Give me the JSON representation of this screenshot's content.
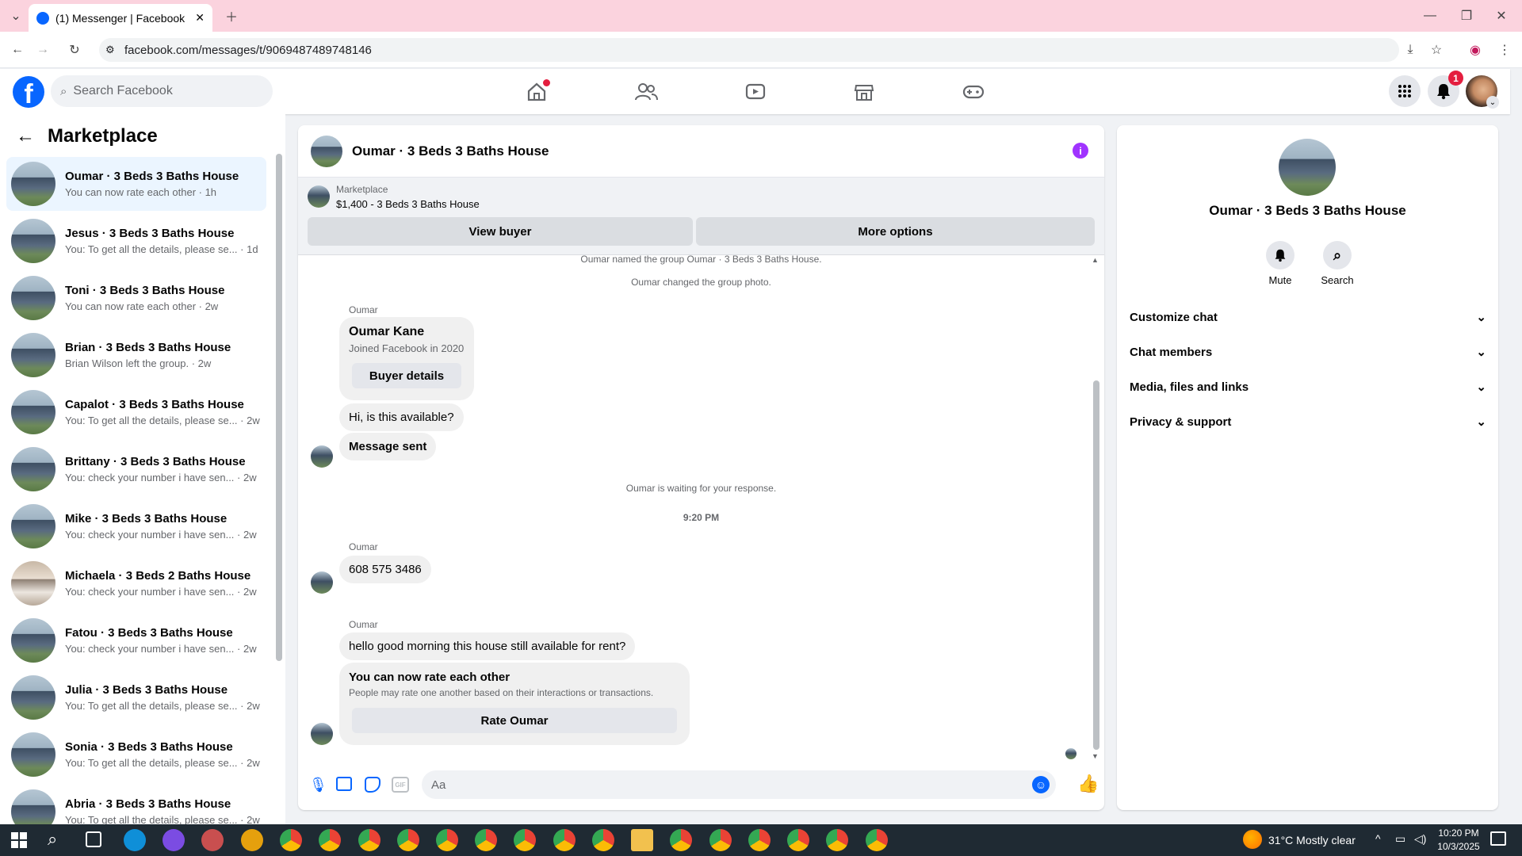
{
  "browser": {
    "tab_title": "(1) Messenger | Facebook",
    "url": "facebook.com/messages/t/9069487489748146"
  },
  "header": {
    "search_placeholder": "Search Facebook",
    "notification_count": "1"
  },
  "sidebar": {
    "title": "Marketplace",
    "conversations": [
      {
        "title": "Oumar · 3 Beds 3 Baths House",
        "preview": "You can now rate each other · 1h"
      },
      {
        "title": "Jesus · 3 Beds 3 Baths House",
        "preview": "You: To get all the details, please se... · 1d"
      },
      {
        "title": "Toni · 3 Beds 3 Baths House",
        "preview": "You can now rate each other · 2w"
      },
      {
        "title": "Brian · 3 Beds 3 Baths House",
        "preview": "Brian Wilson left the group. · 2w"
      },
      {
        "title": "Capalot · 3 Beds 3 Baths House",
        "preview": "You: To get all the details, please se... · 2w"
      },
      {
        "title": "Brittany · 3 Beds 3 Baths House",
        "preview": "You: check your number i have sen... · 2w"
      },
      {
        "title": "Mike · 3 Beds 3 Baths House",
        "preview": "You: check your number i have sen... · 2w"
      },
      {
        "title": "Michaela · 3 Beds 2 Baths House",
        "preview": "You: check your number i have sen... · 2w"
      },
      {
        "title": "Fatou · 3 Beds 3 Baths House",
        "preview": "You: check your number i have sen... · 2w"
      },
      {
        "title": "Julia · 3 Beds 3 Baths House",
        "preview": "You: To get all the details, please se... · 2w"
      },
      {
        "title": "Sonia · 3 Beds 3 Baths House",
        "preview": "You: To get all the details, please se... · 2w"
      },
      {
        "title": "Abria · 3 Beds 3 Baths House",
        "preview": "You: To get all the details, please se... · 2w"
      }
    ]
  },
  "chat": {
    "title": "Oumar · 3 Beds 3 Baths House",
    "listing_source": "Marketplace",
    "listing_title": "$1,400 - 3 Beds 3 Baths House",
    "view_buyer": "View buyer",
    "more_options": "More options",
    "sys1": "Oumar named the group Oumar · 3 Beds 3 Baths House.",
    "sys2": "Oumar changed the group photo.",
    "sender": "Oumar",
    "card_name": "Oumar Kane",
    "card_sub": "Joined Facebook in 2020",
    "buyer_details": "Buyer details",
    "msg1": "Hi, is this available?",
    "msg2": "Message sent",
    "waiting": "Oumar is waiting for your response.",
    "time": "9:20 PM",
    "msg3": "608 575 3486",
    "msg4": "hello good morning this house still available for rent?",
    "rate_title": "You can now rate each other",
    "rate_sub": "People may rate one another based on their interactions or transactions.",
    "rate_button": "Rate Oumar",
    "composer_placeholder": "Aa"
  },
  "details": {
    "name": "Oumar · 3 Beds 3 Baths House",
    "mute": "Mute",
    "search": "Search",
    "sections": [
      "Customize chat",
      "Chat members",
      "Media, files and links",
      "Privacy & support"
    ]
  },
  "taskbar": {
    "weather": "31°C  Mostly clear",
    "time": "10:20 PM",
    "date": "10/3/2025"
  },
  "colors": {
    "fb_blue": "#0866ff",
    "accent_purple": "#a033ff",
    "notif_red": "#e41e3f"
  }
}
